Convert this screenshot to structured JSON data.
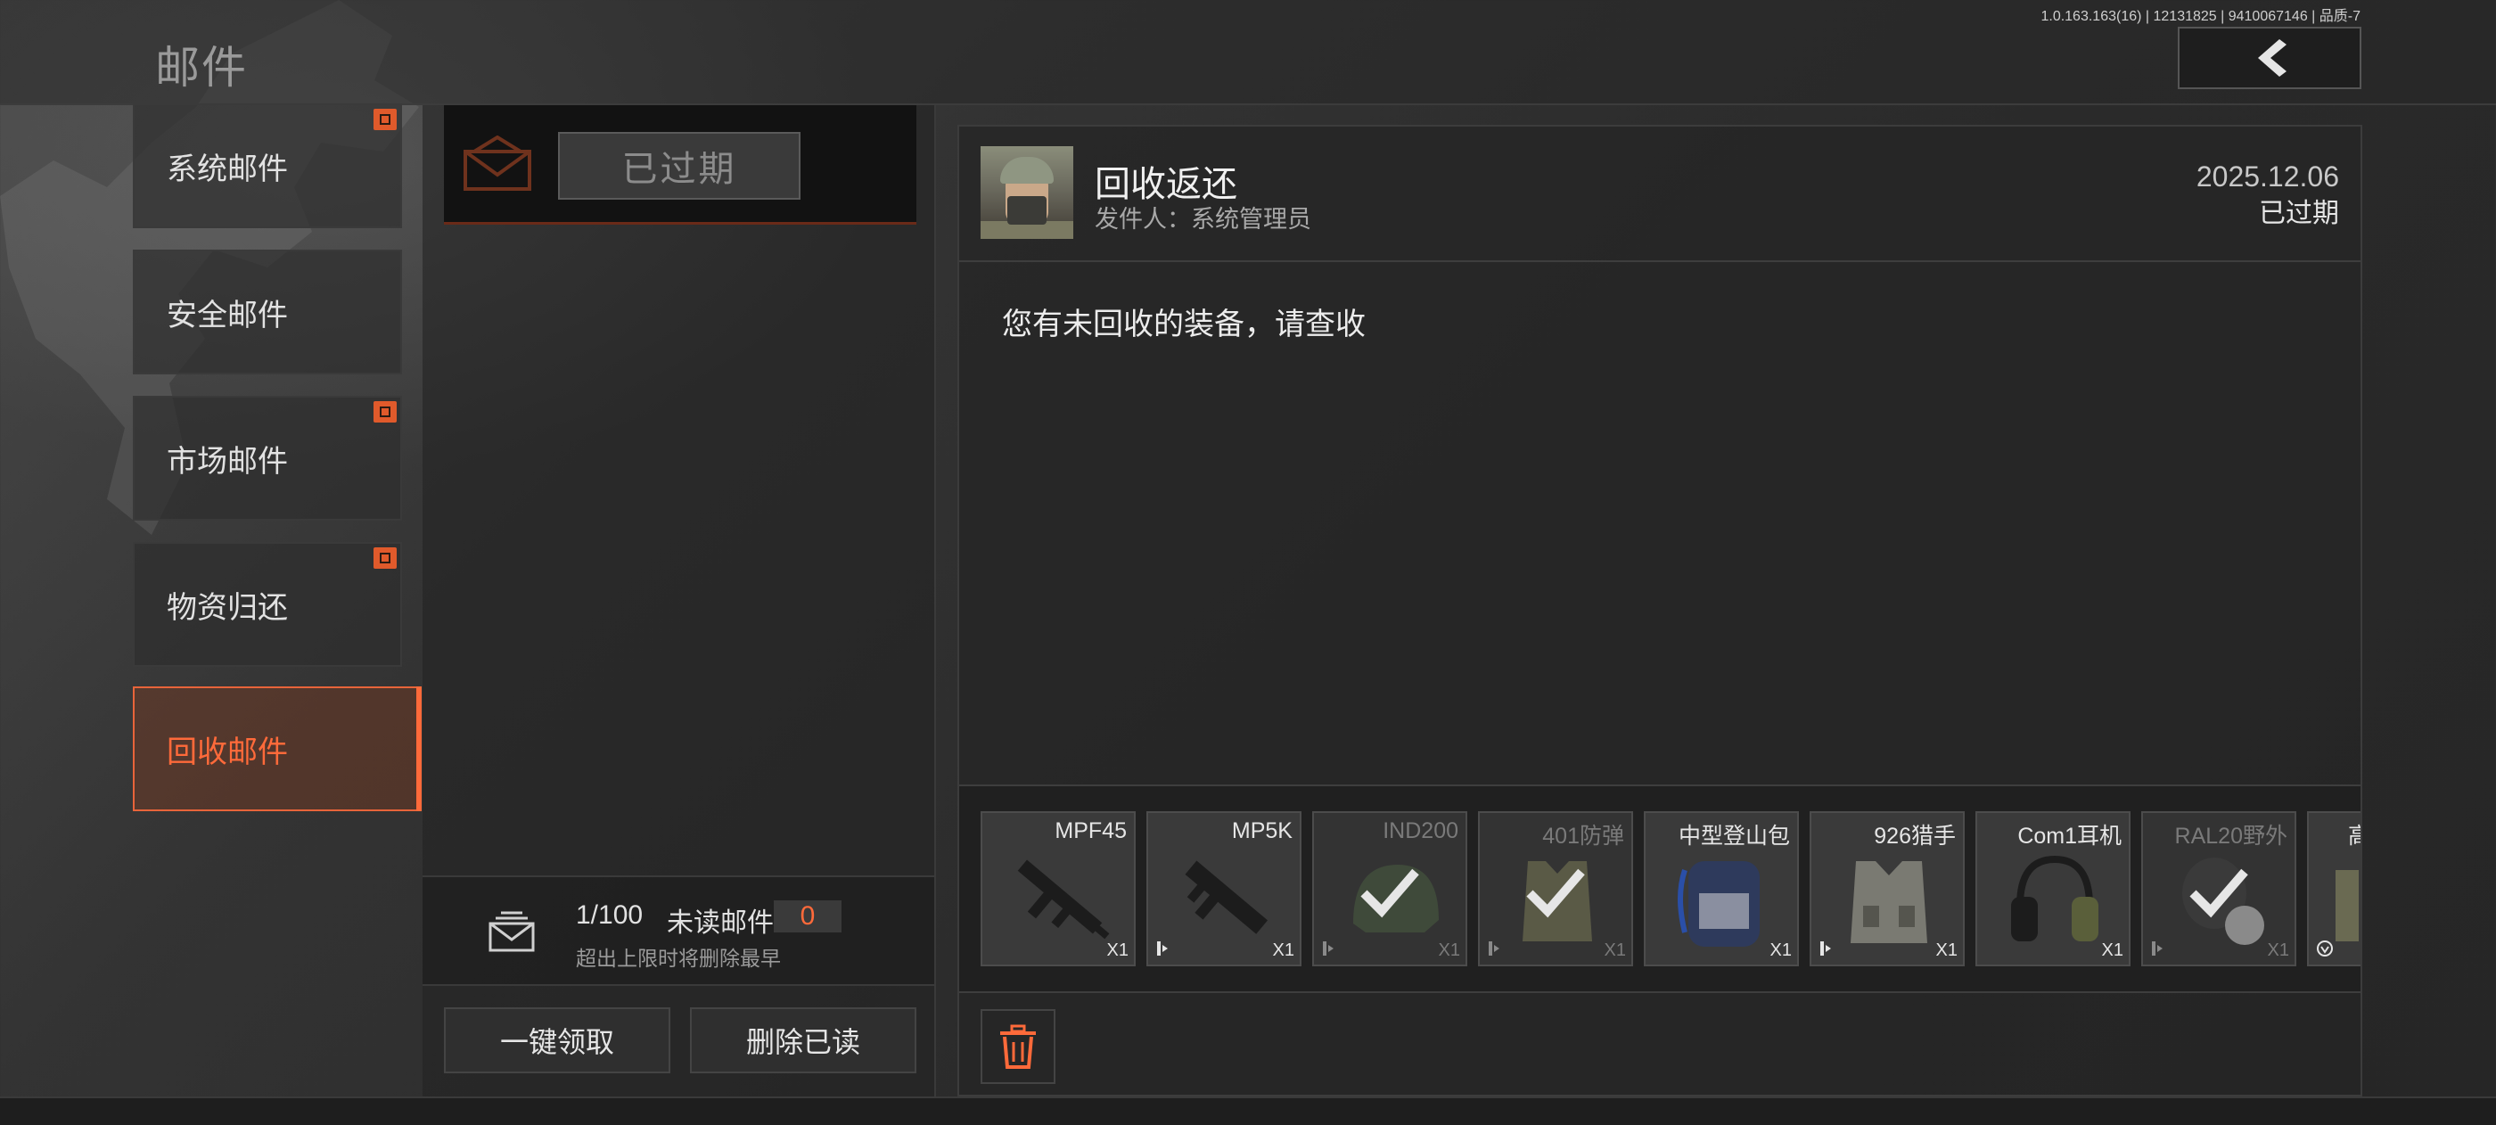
{
  "header": {
    "title": "邮件",
    "version": "1.0.163.163(16) | 12131825 | 9410067146 | 品质-7"
  },
  "categories": [
    {
      "label": "系统邮件",
      "has_gift": true
    },
    {
      "label": "安全邮件",
      "has_gift": false
    },
    {
      "label": "市场邮件",
      "has_gift": true
    },
    {
      "label": "物资归还",
      "has_gift": true
    },
    {
      "label": "回收邮件",
      "has_gift": false,
      "active": true
    }
  ],
  "mail_list": {
    "items": [
      {
        "status": "已过期"
      }
    ],
    "count": "1/100",
    "unread_label": "未读邮件",
    "unread_count": "0",
    "hint": "超出上限时将删除最早",
    "claim_all": "一键领取",
    "delete_read": "删除已读"
  },
  "detail": {
    "title": "回收返还",
    "sender": "发件人：系统管理员",
    "date": "2025.12.06",
    "status": "已过期",
    "body": "您有未回收的装备，请查收",
    "attachments": [
      {
        "name": "MPF45",
        "qty": "X1",
        "claimed": false
      },
      {
        "name": "MP5K",
        "qty": "X1",
        "claimed": false
      },
      {
        "name": "IND200",
        "qty": "X1",
        "claimed": true
      },
      {
        "name": "401防弹",
        "qty": "X1",
        "claimed": true
      },
      {
        "name": "中型登山包",
        "qty": "X1",
        "claimed": false
      },
      {
        "name": "926猎手",
        "qty": "X1",
        "claimed": false
      },
      {
        "name": "Com1耳机",
        "qty": "X1",
        "claimed": false
      },
      {
        "name": "RAL20野外",
        "qty": "X1",
        "claimed": true
      },
      {
        "name": "高",
        "qty": "",
        "claimed": false
      }
    ]
  },
  "colors": {
    "accent": "#ff6a3a",
    "gift_badge": "#e05a2b"
  }
}
